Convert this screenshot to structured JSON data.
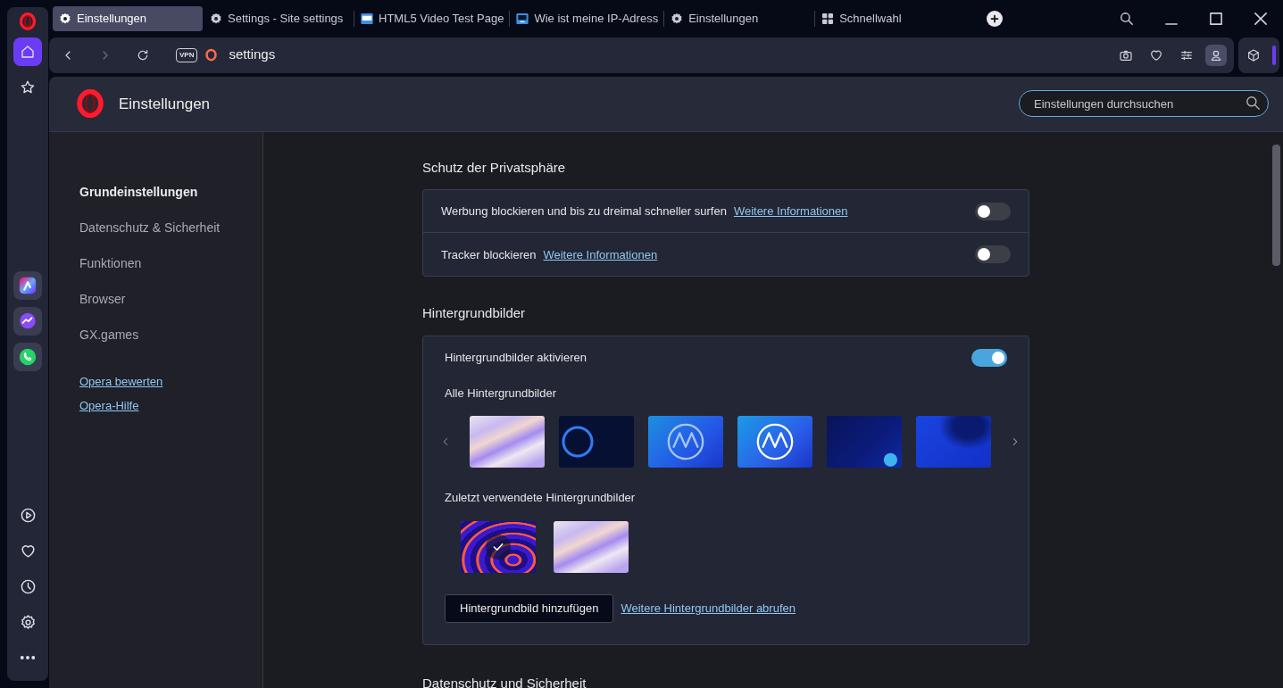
{
  "sidebar": {
    "items": [
      {
        "kind": "home",
        "selected": true
      },
      {
        "kind": "star",
        "selected": false
      }
    ],
    "apps": [
      {
        "kind": "aria"
      },
      {
        "kind": "messenger"
      },
      {
        "kind": "whatsapp"
      }
    ],
    "tools": [
      {
        "kind": "player"
      },
      {
        "kind": "heart"
      },
      {
        "kind": "history"
      },
      {
        "kind": "settings"
      },
      {
        "kind": "more"
      }
    ]
  },
  "tabs": [
    {
      "label": "Einstellungen",
      "kind": "gear",
      "selected": true
    },
    {
      "label": "Settings - Site settings",
      "kind": "gear",
      "selected": false
    },
    {
      "label": "HTML5 Video Test Page",
      "kind": "video",
      "selected": false
    },
    {
      "label": "Wie ist meine IP-Adress",
      "kind": "monitor",
      "selected": false
    },
    {
      "label": "Einstellungen",
      "kind": "gear",
      "selected": false
    },
    {
      "label": "Schnellwahl",
      "kind": "grid",
      "selected": false
    }
  ],
  "address_bar": {
    "vpn_badge": "VPN",
    "url": "settings"
  },
  "settings_header": {
    "title": "Einstellungen",
    "search": {
      "placeholder": "Einstellungen durchsuchen"
    }
  },
  "nav": {
    "items": [
      {
        "label": "Grundeinstellungen",
        "selected": true
      },
      {
        "label": "Datenschutz & Sicherheit",
        "selected": false
      },
      {
        "label": "Funktionen",
        "selected": false
      },
      {
        "label": "Browser",
        "selected": false
      },
      {
        "label": "GX.games",
        "selected": false
      }
    ],
    "links": [
      "Opera bewerten",
      "Opera-Hilfe"
    ]
  },
  "privacy": {
    "heading": "Schutz der Privatsphäre",
    "rows": [
      {
        "label": "Werbung blockieren und bis zu dreimal schneller surfen",
        "link": "Weitere Informationen",
        "on": false
      },
      {
        "label": "Tracker blockieren",
        "link": "Weitere Informationen",
        "on": false
      }
    ]
  },
  "wallpapers": {
    "heading": "Hintergrundbilder",
    "toggle": {
      "label": "Hintergrundbilder aktivieren",
      "on": true
    },
    "all_label": "Alle Hintergrundbilder",
    "all": [
      {
        "kind": "pastel"
      },
      {
        "kind": "ring"
      },
      {
        "kind": "logo-soft"
      },
      {
        "kind": "logo"
      },
      {
        "kind": "dark-globe"
      },
      {
        "kind": "blue-wave"
      }
    ],
    "recent_label": "Zuletzt verwendete Hintergrundbilder",
    "recent": [
      {
        "kind": "swirl",
        "selected": true
      },
      {
        "kind": "pastel",
        "selected": false
      }
    ],
    "add_button": "Hintergrundbild hinzufügen",
    "more_link": "Weitere Hintergrundbilder abrufen"
  },
  "next_heading": "Datenschutz und Sicherheit"
}
